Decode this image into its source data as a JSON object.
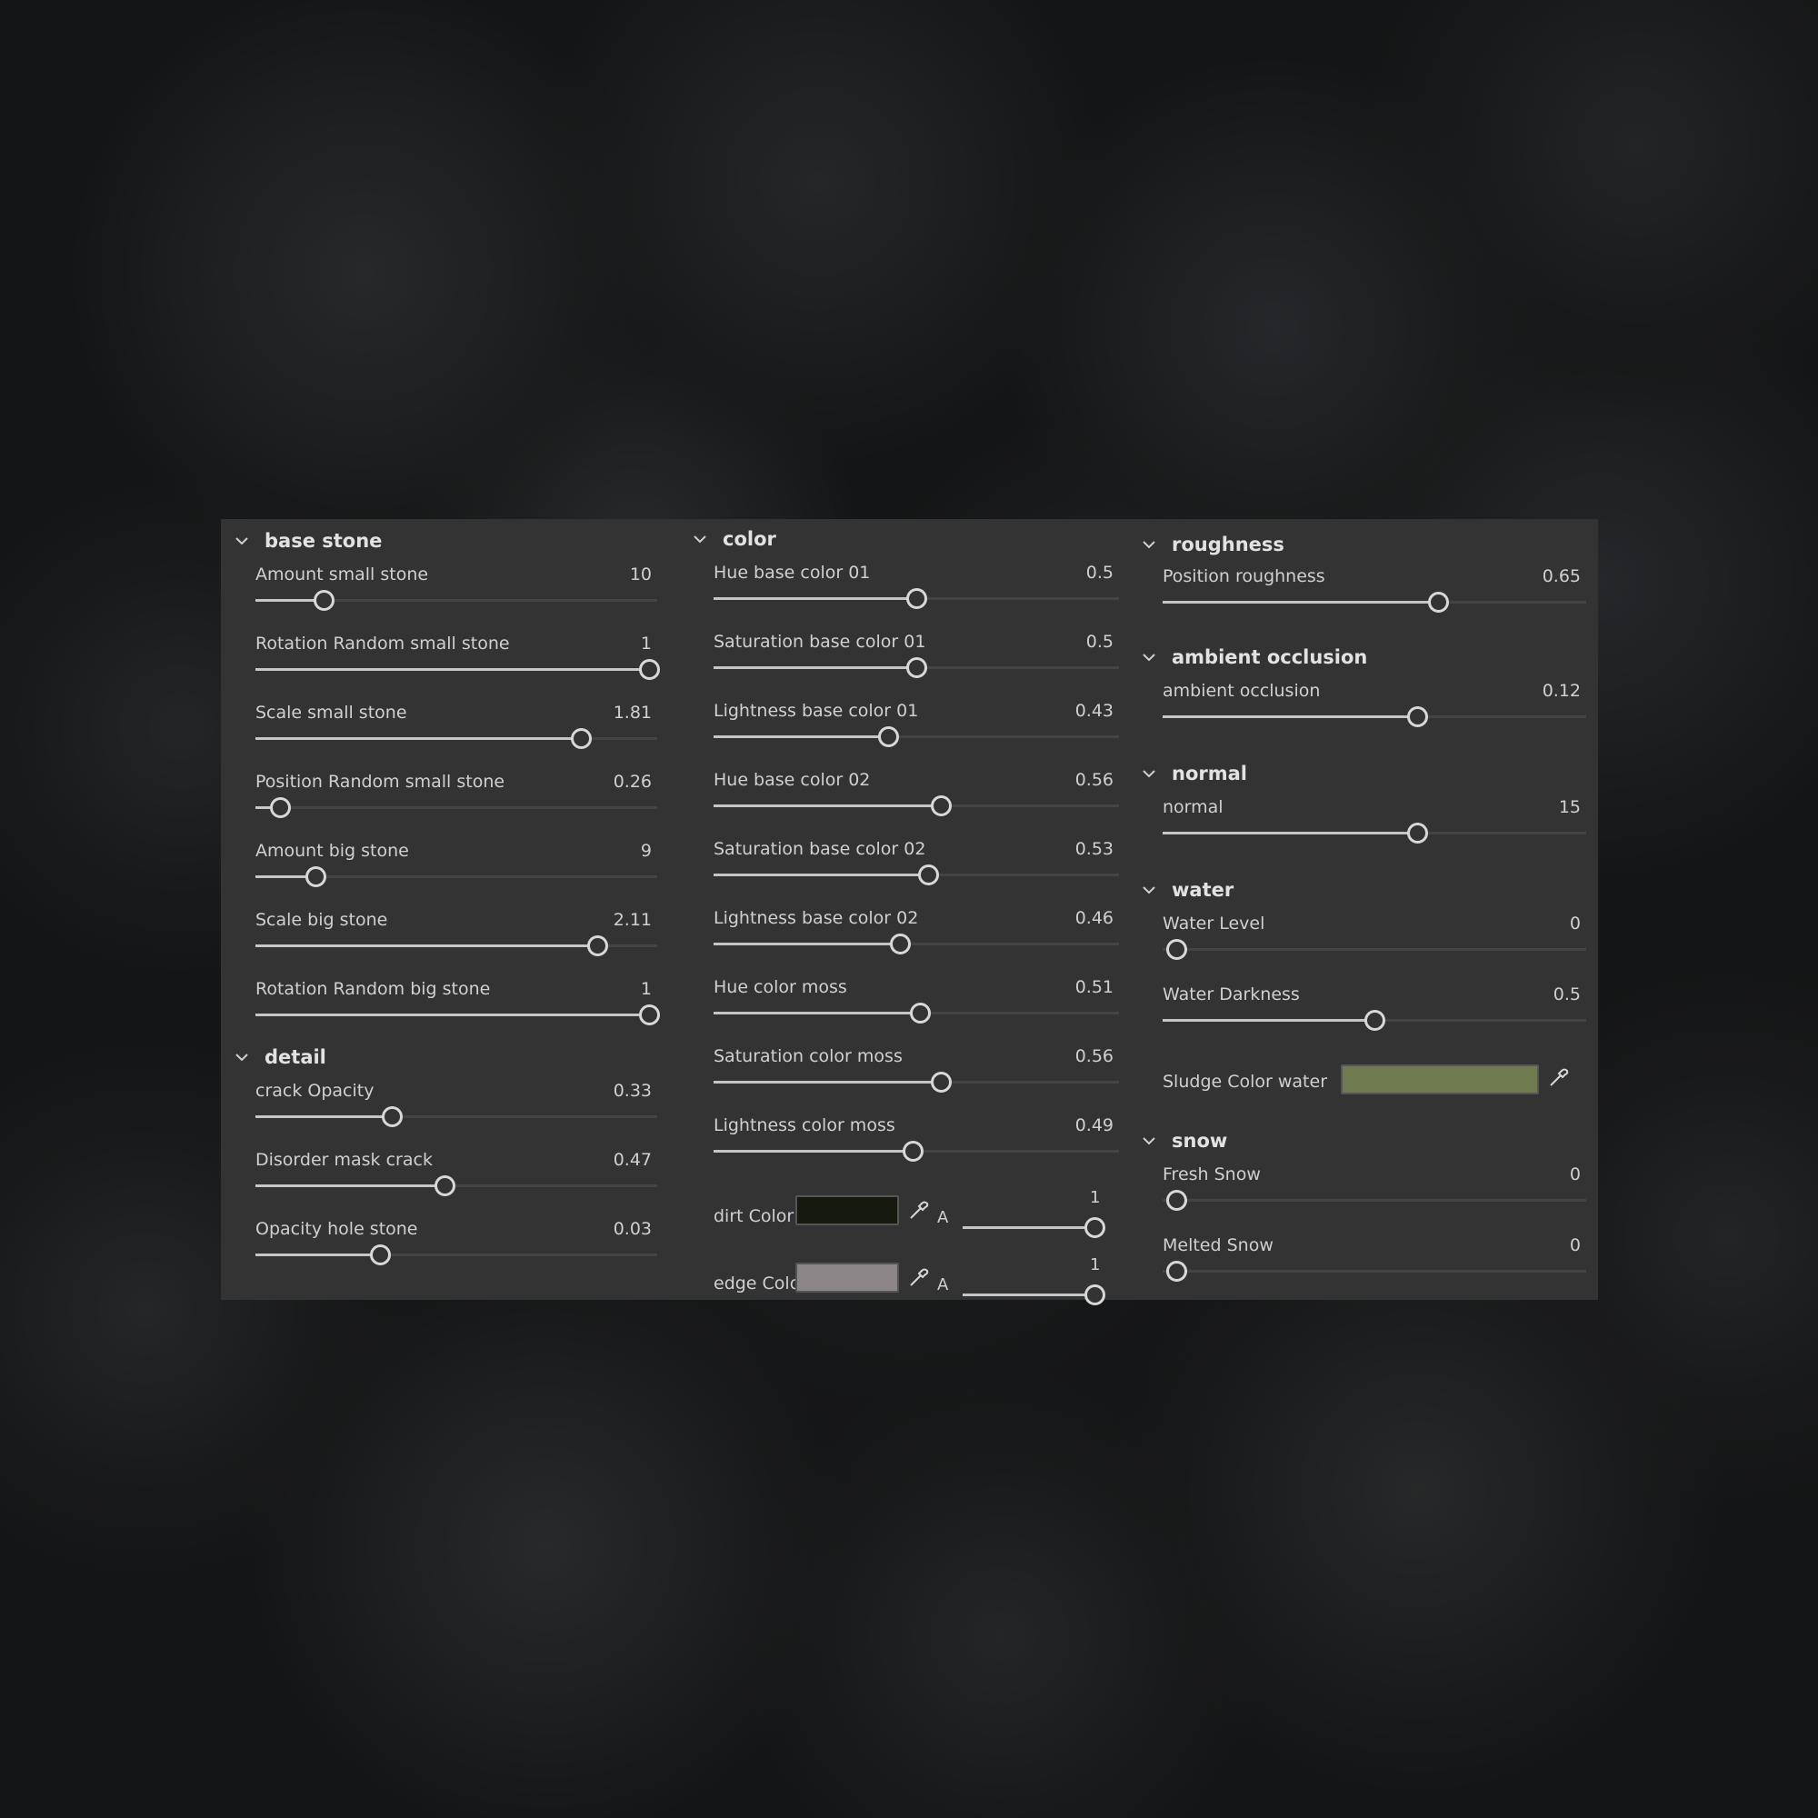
{
  "sections": {
    "base_stone": {
      "title": "base stone",
      "params": [
        {
          "label": "Amount small stone",
          "value": "10",
          "fraction": 0.17
        },
        {
          "label": "Rotation Random small stone",
          "value": "1",
          "fraction": 1.0
        },
        {
          "label": "Scale small stone",
          "value": "1.81",
          "fraction": 0.81
        },
        {
          "label": "Position Random small stone",
          "value": "0.26",
          "fraction": 0.06
        },
        {
          "label": "Amount big stone",
          "value": "9",
          "fraction": 0.15
        },
        {
          "label": "Scale big stone",
          "value": "2.11",
          "fraction": 0.85
        },
        {
          "label": "Rotation Random big stone",
          "value": "1",
          "fraction": 1.0
        }
      ]
    },
    "detail": {
      "title": "detail",
      "params": [
        {
          "label": "crack Opacity",
          "value": "0.33",
          "fraction": 0.34
        },
        {
          "label": "Disorder mask crack",
          "value": "0.47",
          "fraction": 0.47
        },
        {
          "label": "Opacity hole stone",
          "value": "0.03",
          "fraction": 0.31
        }
      ]
    },
    "color": {
      "title": "color",
      "params": [
        {
          "label": "Hue base color 01",
          "value": "0.5",
          "fraction": 0.5
        },
        {
          "label": "Saturation base color 01",
          "value": "0.5",
          "fraction": 0.5
        },
        {
          "label": "Lightness base color 01",
          "value": "0.43",
          "fraction": 0.43
        },
        {
          "label": "Hue base color 02",
          "value": "0.56",
          "fraction": 0.56
        },
        {
          "label": "Saturation base color 02",
          "value": "0.53",
          "fraction": 0.53
        },
        {
          "label": "Lightness base color 02",
          "value": "0.46",
          "fraction": 0.46
        },
        {
          "label": "Hue color moss",
          "value": "0.51",
          "fraction": 0.51
        },
        {
          "label": "Saturation color moss",
          "value": "0.56",
          "fraction": 0.56
        },
        {
          "label": "Lightness color moss",
          "value": "0.49",
          "fraction": 0.49
        }
      ],
      "colors": [
        {
          "label": "dirt Color",
          "swatch": "#161a0e",
          "alpha_label": "A",
          "alpha_value": "1",
          "alpha_fraction": 1.0
        },
        {
          "label": "edge Color",
          "swatch": "#8c8688",
          "alpha_label": "A",
          "alpha_value": "1",
          "alpha_fraction": 1.0
        }
      ]
    },
    "roughness": {
      "title": "roughness",
      "params": [
        {
          "label": "Position roughness",
          "value": "0.65",
          "fraction": 0.65
        }
      ]
    },
    "ambient_occlusion": {
      "title": "ambient occlusion",
      "params": [
        {
          "label": "ambient occlusion",
          "value": "0.12",
          "fraction": 0.6
        }
      ]
    },
    "normal": {
      "title": "normal",
      "params": [
        {
          "label": "normal",
          "value": "15",
          "fraction": 0.6
        }
      ]
    },
    "water": {
      "title": "water",
      "params": [
        {
          "label": "Water Level",
          "value": "0",
          "fraction": 0.0
        },
        {
          "label": "Water Darkness",
          "value": "0.5",
          "fraction": 0.5
        }
      ],
      "color": {
        "label": "Sludge Color water",
        "swatch": "#6f7a4e"
      }
    },
    "snow": {
      "title": "snow",
      "params": [
        {
          "label": "Fresh Snow",
          "value": "0",
          "fraction": 0.0
        },
        {
          "label": "Melted Snow",
          "value": "0",
          "fraction": 0.0
        }
      ]
    }
  },
  "icons": {
    "chevron": "chevron-down-icon",
    "picker": "eyedropper-icon"
  }
}
